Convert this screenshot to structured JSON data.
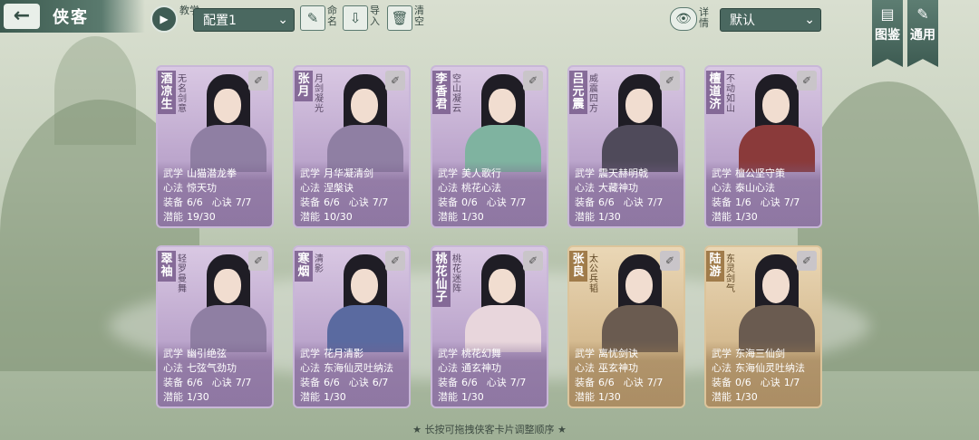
{
  "header": {
    "back_icon": "left-arrow-icon",
    "title": "侠客",
    "tutorial_label": "教学",
    "config_value": "配置1",
    "rename_label": "命名",
    "import_label": "导入",
    "clear_label": "清空",
    "detail_label": "详情",
    "sort_value": "默认",
    "atlas_label": "图鉴",
    "general_label": "通用"
  },
  "cards": [
    {
      "name": "酒凉生",
      "nick": "无名剑意",
      "skill_k": "武学",
      "skill": "山猫潜龙拳",
      "heart_k": "心法",
      "heart": "惊天功",
      "equip_k": "装备",
      "equip": "6/6",
      "jue_k": "心诀",
      "jue": "7/7",
      "pot_k": "潜能",
      "pot": "19/30"
    },
    {
      "name": "张月",
      "nick": "月剑凝光",
      "skill_k": "武学",
      "skill": "月华凝清剑",
      "heart_k": "心法",
      "heart": "涅槃诀",
      "equip_k": "装备",
      "equip": "6/6",
      "jue_k": "心诀",
      "jue": "7/7",
      "pot_k": "潜能",
      "pot": "10/30"
    },
    {
      "name": "李香君",
      "nick": "空山凝云",
      "skill_k": "武学",
      "skill": "美人歌行",
      "heart_k": "心法",
      "heart": "桃花心法",
      "equip_k": "装备",
      "equip": "0/6",
      "jue_k": "心诀",
      "jue": "7/7",
      "pot_k": "潜能",
      "pot": "1/30"
    },
    {
      "name": "吕元震",
      "nick": "威震四方",
      "skill_k": "武学",
      "skill": "震天赫明戟",
      "heart_k": "心法",
      "heart": "大藏神功",
      "equip_k": "装备",
      "equip": "6/6",
      "jue_k": "心诀",
      "jue": "7/7",
      "pot_k": "潜能",
      "pot": "1/30"
    },
    {
      "name": "檀道济",
      "nick": "不动如山",
      "skill_k": "武学",
      "skill": "檀公坚守策",
      "heart_k": "心法",
      "heart": "泰山心法",
      "equip_k": "装备",
      "equip": "1/6",
      "jue_k": "心诀",
      "jue": "7/7",
      "pot_k": "潜能",
      "pot": "1/30"
    },
    {
      "name": "翠袖",
      "nick": "轻罗曼舞",
      "skill_k": "武学",
      "skill": "幽引绝弦",
      "heart_k": "心法",
      "heart": "七弦气劲功",
      "equip_k": "装备",
      "equip": "6/6",
      "jue_k": "心诀",
      "jue": "7/7",
      "pot_k": "潜能",
      "pot": "1/30"
    },
    {
      "name": "寒烟",
      "nick": "清影",
      "skill_k": "武学",
      "skill": "花月清影",
      "heart_k": "心法",
      "heart": "东海仙灵吐纳法",
      "equip_k": "装备",
      "equip": "6/6",
      "jue_k": "心诀",
      "jue": "6/7",
      "pot_k": "潜能",
      "pot": "1/30"
    },
    {
      "name": "桃花仙子",
      "nick": "桃花迷阵",
      "skill_k": "武学",
      "skill": "桃花幻舞",
      "heart_k": "心法",
      "heart": "通玄神功",
      "equip_k": "装备",
      "equip": "6/6",
      "jue_k": "心诀",
      "jue": "7/7",
      "pot_k": "潜能",
      "pot": "1/30"
    },
    {
      "name": "张良",
      "nick": "太公兵韬",
      "skill_k": "武学",
      "skill": "离忧剑诀",
      "heart_k": "心法",
      "heart": "巫玄神功",
      "equip_k": "装备",
      "equip": "6/6",
      "jue_k": "心诀",
      "jue": "7/7",
      "pot_k": "潜能",
      "pot": "1/30"
    },
    {
      "name": "陆游",
      "nick": "东灵剑气",
      "skill_k": "武学",
      "skill": "东海三仙剑",
      "heart_k": "心法",
      "heart": "东海仙灵吐纳法",
      "equip_k": "装备",
      "equip": "0/6",
      "jue_k": "心诀",
      "jue": "1/7",
      "pot_k": "潜能",
      "pot": "1/30"
    }
  ],
  "footer": "★ 长按可拖拽侠客卡片调整顺序 ★"
}
